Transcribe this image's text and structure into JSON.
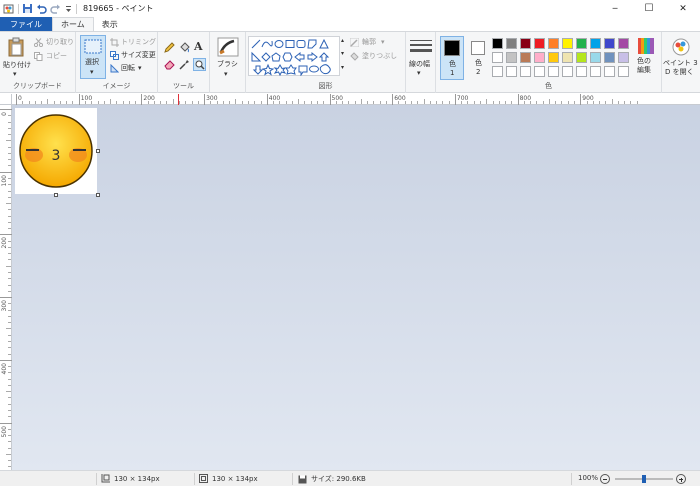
{
  "window": {
    "title": "819665 - ペイント",
    "minimize_glyph": "─",
    "maximize_glyph": "☐",
    "close_glyph": "✕"
  },
  "tabs": [
    {
      "label": "ファイル"
    },
    {
      "label": "ホーム"
    },
    {
      "label": "表示"
    }
  ],
  "ribbon": {
    "clipboard": {
      "group_label": "クリップボード",
      "paste": "貼り付け",
      "cut": "切り取り",
      "copy": "コピー"
    },
    "image": {
      "group_label": "イメージ",
      "select": "選択",
      "crop": "トリミング",
      "resize": "サイズ変更",
      "rotate": "回転"
    },
    "tools": {
      "group_label": "ツール",
      "text_glyph": "A"
    },
    "brushes": {
      "label": "ブラシ"
    },
    "shapes": {
      "group_label": "図形",
      "outline": "輪郭",
      "fill": "塗りつぶし"
    },
    "size": {
      "label": "線の幅"
    },
    "colors": {
      "group_label": "色",
      "color1": "色\n1",
      "color1_a": "色",
      "color1_b": "1",
      "color2_a": "色",
      "color2_b": "2",
      "edit_a": "色の",
      "edit_b": "編集",
      "palette_row1": [
        "#000000",
        "#7f7f7f",
        "#880015",
        "#ed1c24",
        "#ff7f27",
        "#fff200",
        "#22b14c",
        "#00a2e8",
        "#3f48cc",
        "#a349a4"
      ],
      "palette_row2": [
        "#ffffff",
        "#c3c3c3",
        "#b97a57",
        "#ffaec9",
        "#ffc90e",
        "#efe4b0",
        "#b5e61d",
        "#99d9ea",
        "#7092be",
        "#c8bfe7"
      ],
      "palette_row3": [
        "#ffffff",
        "#ffffff",
        "#ffffff",
        "#ffffff",
        "#ffffff",
        "#ffffff",
        "#ffffff",
        "#ffffff",
        "#ffffff",
        "#ffffff"
      ]
    },
    "paint3d": {
      "label_a": "ペイント 3",
      "label_b": "D を開く"
    }
  },
  "ruler": {
    "h_labels": [
      "0",
      "100",
      "200",
      "300",
      "400",
      "500",
      "600",
      "700",
      "800",
      "900"
    ],
    "v_labels": [
      "0",
      "100",
      "200",
      "300",
      "400",
      "500"
    ]
  },
  "canvas": {
    "emoji_mouth": "3"
  },
  "status": {
    "selection_size": "130 × 134px",
    "image_size": "130 × 134px",
    "file_size": "サイズ: 290.6KB",
    "zoom": "100%",
    "zoom_level_fraction": 0.5
  }
}
